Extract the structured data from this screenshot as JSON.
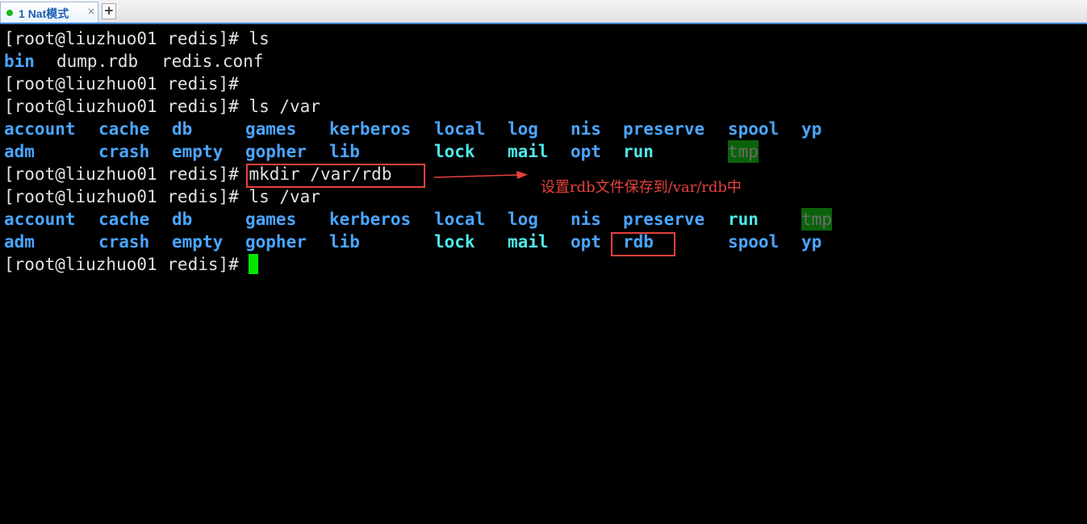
{
  "tabs": [
    {
      "index": "1",
      "label": "Nat模式",
      "status_color": "#1fb81f",
      "active": true
    }
  ],
  "tab_close": "×",
  "tab_add": "+",
  "terminal": {
    "cmd1": "[root@liuzhuo01 redis]# ls",
    "ls_redis": [
      {
        "name": "bin",
        "type": "dir"
      },
      {
        "name": "dump.rdb",
        "type": "file"
      },
      {
        "name": "redis.conf",
        "type": "file"
      }
    ],
    "prompt": "[root@liuzhuo01 redis]#",
    "cmd2": "[root@liuzhuo01 redis]# ls /var",
    "ls_var1_row1": [
      "account",
      "cache",
      "db",
      "games",
      "kerberos",
      "local",
      "log",
      "nis",
      "preserve",
      "spool",
      "yp"
    ],
    "ls_var1_row2": [
      "adm",
      "crash",
      "empty",
      "gopher",
      "lib",
      "lock",
      "mail",
      "opt",
      "run",
      "",
      "tmp"
    ],
    "mkdir_cmd": "mkdir /var/rdb",
    "cmd4": "[root@liuzhuo01 redis]# ls /var",
    "ls_var2_row1": [
      "account",
      "cache",
      "db",
      "games",
      "kerberos",
      "local",
      "log",
      "nis",
      "preserve",
      "run",
      "tmp"
    ],
    "ls_var2_row2": [
      "adm",
      "crash",
      "empty",
      "gopher",
      "lib",
      "lock",
      "mail",
      "opt",
      "rdb",
      "spool",
      "yp"
    ]
  },
  "annotation": {
    "text": "设置rdb文件保存到/var/rdb中",
    "color": "#e8413d"
  },
  "colors": {
    "directory": "#4aa5ff",
    "symlink": "#4ee8e8",
    "tmp_background": "#0a630a",
    "cursor": "#00e600",
    "tab_accent": "#3c86d6"
  }
}
